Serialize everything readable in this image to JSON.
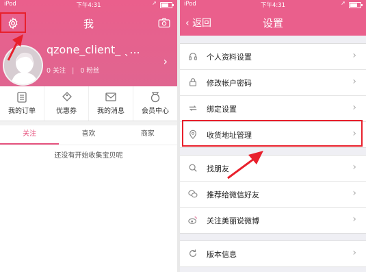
{
  "left": {
    "status": {
      "carrier": "iPod",
      "time": "下午4:31"
    },
    "title": "我",
    "profile": {
      "username": "qzone_client_ ˎ...",
      "following": "0 关注",
      "followers": "0 粉丝"
    },
    "menu": [
      {
        "label": "我的订单",
        "icon": "list-icon"
      },
      {
        "label": "优惠券",
        "icon": "coupon-icon"
      },
      {
        "label": "我的消息",
        "icon": "mail-icon"
      },
      {
        "label": "会员中心",
        "icon": "medal-icon"
      }
    ],
    "tabs": [
      "关注",
      "喜欢",
      "商家"
    ],
    "active_tab": "关注",
    "empty_text": "还没有开始收集宝贝呢"
  },
  "right": {
    "status": {
      "carrier": "iPod",
      "time": "下午4:31"
    },
    "back_label": "返回",
    "title": "设置",
    "group1": [
      {
        "label": "个人资料设置",
        "icon": "headphones-icon"
      },
      {
        "label": "修改帐户密码",
        "icon": "lock-icon"
      },
      {
        "label": "绑定设置",
        "icon": "bind-icon"
      },
      {
        "label": "收货地址管理",
        "icon": "location-pin-icon"
      }
    ],
    "group2": [
      {
        "label": "找朋友",
        "icon": "search-icon"
      },
      {
        "label": "推荐给微信好友",
        "icon": "wechat-icon"
      },
      {
        "label": "关注美丽说微博",
        "icon": "weibo-icon"
      }
    ],
    "group3": [
      {
        "label": "版本信息",
        "icon": "refresh-icon"
      }
    ]
  },
  "colors": {
    "brand_pink": "#ea5f8c",
    "annotation_red": "#e8202c"
  }
}
